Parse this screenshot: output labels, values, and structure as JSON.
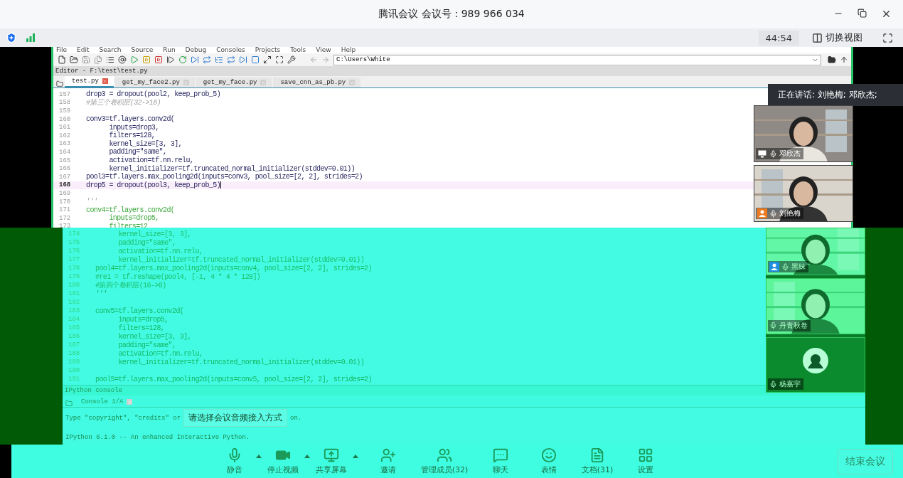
{
  "window": {
    "title": "腾讯会议 会议号：989 966 034"
  },
  "meeting_bar": {
    "timer": "44:54",
    "switch_view": "切换视图"
  },
  "ide": {
    "menu": [
      "File",
      "Edit",
      "Search",
      "Source",
      "Run",
      "Debug",
      "Consoles",
      "Projects",
      "Tools",
      "View",
      "Help"
    ],
    "path": "C:\\Users\\White",
    "editor_title": "Editor - F:\\test\\test.py",
    "tabs": [
      {
        "label": "test.py",
        "selected": true
      },
      {
        "label": "get_my_face2.py",
        "selected": false
      },
      {
        "label": "get_my_face.py",
        "selected": false
      },
      {
        "label": "save_cnn_as_pb.py",
        "selected": false
      }
    ],
    "upper_lines": [
      {
        "no": "157",
        "text": "drop3 = dropout(pool2, keep_prob_5)",
        "kind": "code",
        "current": false
      },
      {
        "no": "158",
        "text": "#第三个卷积层(32->16)",
        "kind": "comment",
        "current": false
      },
      {
        "no": "159",
        "current": false
      },
      {
        "no": "160",
        "text": "conv3=tf.layers.conv2d(",
        "kind": "code",
        "current": false
      },
      {
        "no": "161",
        "text": "      inputs=drop3,",
        "kind": "code",
        "current": false
      },
      {
        "no": "162",
        "text": "      filters=128,",
        "kind": "code",
        "current": false
      },
      {
        "no": "163",
        "text": "      kernel_size=[3, 3],",
        "kind": "code",
        "current": false
      },
      {
        "no": "164",
        "text": "      padding=\"same\",",
        "kind": "code",
        "current": false
      },
      {
        "no": "165",
        "text": "      activation=tf.nn.relu,",
        "kind": "code",
        "current": false
      },
      {
        "no": "166",
        "text": "      kernel_initializer=tf.truncated_normal_initializer(stddev=0.01))",
        "kind": "code",
        "current": false
      },
      {
        "no": "167",
        "text": "pool3=tf.layers.max_pooling2d(inputs=conv3, pool_size=[2, 2], strides=2)",
        "kind": "code",
        "current": false
      },
      {
        "no": "168",
        "text": "drop5 = dropout(pool3, keep_prob_5)",
        "kind": "code",
        "current": true
      },
      {
        "no": "169",
        "current": false
      },
      {
        "no": "170",
        "text": "'''",
        "kind": "comment",
        "current": false
      },
      {
        "no": "171",
        "text": "conv4=tf.layers.conv2d(",
        "kind": "docstring",
        "current": false
      },
      {
        "no": "172",
        "text": "      inputs=drop5,",
        "kind": "docstring",
        "current": false
      },
      {
        "no": "173",
        "text": "      filters=12",
        "kind": "docstring",
        "current": false
      }
    ],
    "lower_lines": [
      {
        "no": "174",
        "text": "      kernel_size=[3, 3],",
        "kind": "docstring",
        "current": false
      },
      {
        "no": "175",
        "text": "      padding=\"same\",",
        "kind": "docstring",
        "current": false
      },
      {
        "no": "176",
        "text": "      activation=tf.nn.relu,",
        "kind": "docstring",
        "current": false
      },
      {
        "no": "177",
        "text": "      kernel_initializer=tf.truncated_normal_initializer(stddev=0.01))",
        "kind": "docstring",
        "current": false
      },
      {
        "no": "178",
        "text": "pool4=tf.layers.max_pooling2d(inputs=conv4, pool_size=[2, 2], strides=2)",
        "kind": "docstring",
        "current": false
      },
      {
        "no": "179",
        "text": "#re1 = tf.reshape(pool4, [-1, 4 * 4 * 128])",
        "kind": "docstring",
        "current": false
      },
      {
        "no": "180",
        "text": "#第四个卷积层(16->8)",
        "kind": "docstring",
        "current": false
      },
      {
        "no": "181",
        "text": "'''",
        "kind": "comment",
        "current": false
      },
      {
        "no": "182",
        "current": false
      },
      {
        "no": "183",
        "text": "conv5=tf.layers.conv2d(",
        "kind": "code",
        "current": false
      },
      {
        "no": "184",
        "text": "      inputs=drop5,",
        "kind": "code",
        "current": false
      },
      {
        "no": "185",
        "text": "      filters=128,",
        "kind": "code",
        "current": false
      },
      {
        "no": "186",
        "text": "      kernel_size=[3, 3],",
        "kind": "code",
        "current": false
      },
      {
        "no": "187",
        "text": "      padding=\"same\",",
        "kind": "code",
        "current": false
      },
      {
        "no": "188",
        "text": "      activation=tf.nn.relu,",
        "kind": "code",
        "current": false
      },
      {
        "no": "189",
        "text": "      kernel_initializer=tf.truncated_normal_initializer(stddev=0.01))",
        "kind": "code",
        "current": false
      },
      {
        "no": "190",
        "current": false
      },
      {
        "no": "191",
        "text": "pool5=tf.layers.max_pooling2d(inputs=conv5, pool_size=[2, 2], strides=2)",
        "kind": "code",
        "current": false
      }
    ],
    "console": {
      "title": "IPython console",
      "tab": "Console 1/A",
      "line_start": "Type \"copyright\", \"credits\" or",
      "line_end": "on.",
      "banner": "IPython 6.1.0 -- An enhanced Interactive Python."
    }
  },
  "speaking": "正在讲话: 刘艳梅; 邓欣杰;",
  "audio_tip": "请选择会议音频接入方式",
  "upper_tiles": [
    {
      "name": "邓欣杰",
      "kind": "video",
      "badge": {
        "kind": "screen"
      }
    },
    {
      "name": "刘艳梅",
      "kind": "video",
      "badge": {
        "kind": "person",
        "color": "#f07a1e"
      }
    }
  ],
  "lower_tiles": [
    {
      "name": "黑妹",
      "kind": "video",
      "badge": {
        "kind": "person",
        "color": "#1e8fe0"
      }
    },
    {
      "name": "丹青秋卷",
      "kind": "video"
    },
    {
      "name": "杨嘉宇",
      "kind": "avatar"
    }
  ],
  "toolbar": [
    {
      "label": "静音",
      "kind": "mic",
      "menu": true
    },
    {
      "label": "停止视频",
      "kind": "camera",
      "menu": true
    },
    {
      "label": "共享屏幕",
      "kind": "share",
      "menu": true
    },
    {
      "label": "邀请",
      "kind": "invite",
      "menu": false
    },
    {
      "label": "管理成员(32)",
      "kind": "members",
      "menu": false
    },
    {
      "label": "聊天",
      "kind": "chat",
      "menu": false
    },
    {
      "label": "表情",
      "kind": "emoji",
      "menu": false
    },
    {
      "label": "文档(31)",
      "kind": "docs",
      "menu": false
    },
    {
      "label": "设置",
      "kind": "settings",
      "menu": false
    }
  ],
  "end_button": "结束会议"
}
